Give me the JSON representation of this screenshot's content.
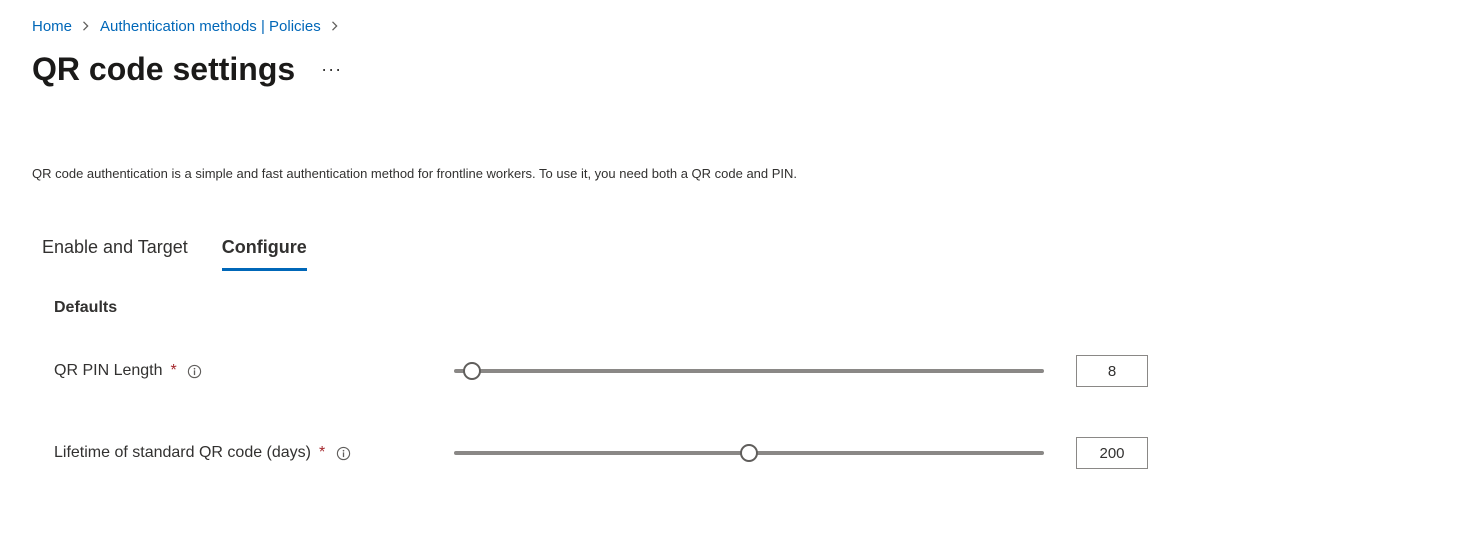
{
  "colors": {
    "accent": "#0067b8",
    "trackFilled": "#8a8886",
    "trackEmpty": "#8a8886",
    "required": "#a4262c"
  },
  "breadcrumb": {
    "items": [
      {
        "label": "Home"
      },
      {
        "label": "Authentication methods | Policies"
      }
    ]
  },
  "title": "QR code settings",
  "description": "QR code authentication is a simple and fast authentication method for frontline workers. To use it, you need both a QR code and PIN.",
  "tabs": [
    {
      "label": "Enable and Target",
      "active": false
    },
    {
      "label": "Configure",
      "active": true
    }
  ],
  "section": {
    "heading": "Defaults"
  },
  "settings": {
    "pin": {
      "label": "QR PIN Length",
      "value": "8",
      "slider": {
        "percent": 3
      }
    },
    "lifetime": {
      "label": "Lifetime of standard QR code (days)",
      "value": "200",
      "slider": {
        "percent": 50
      }
    }
  }
}
